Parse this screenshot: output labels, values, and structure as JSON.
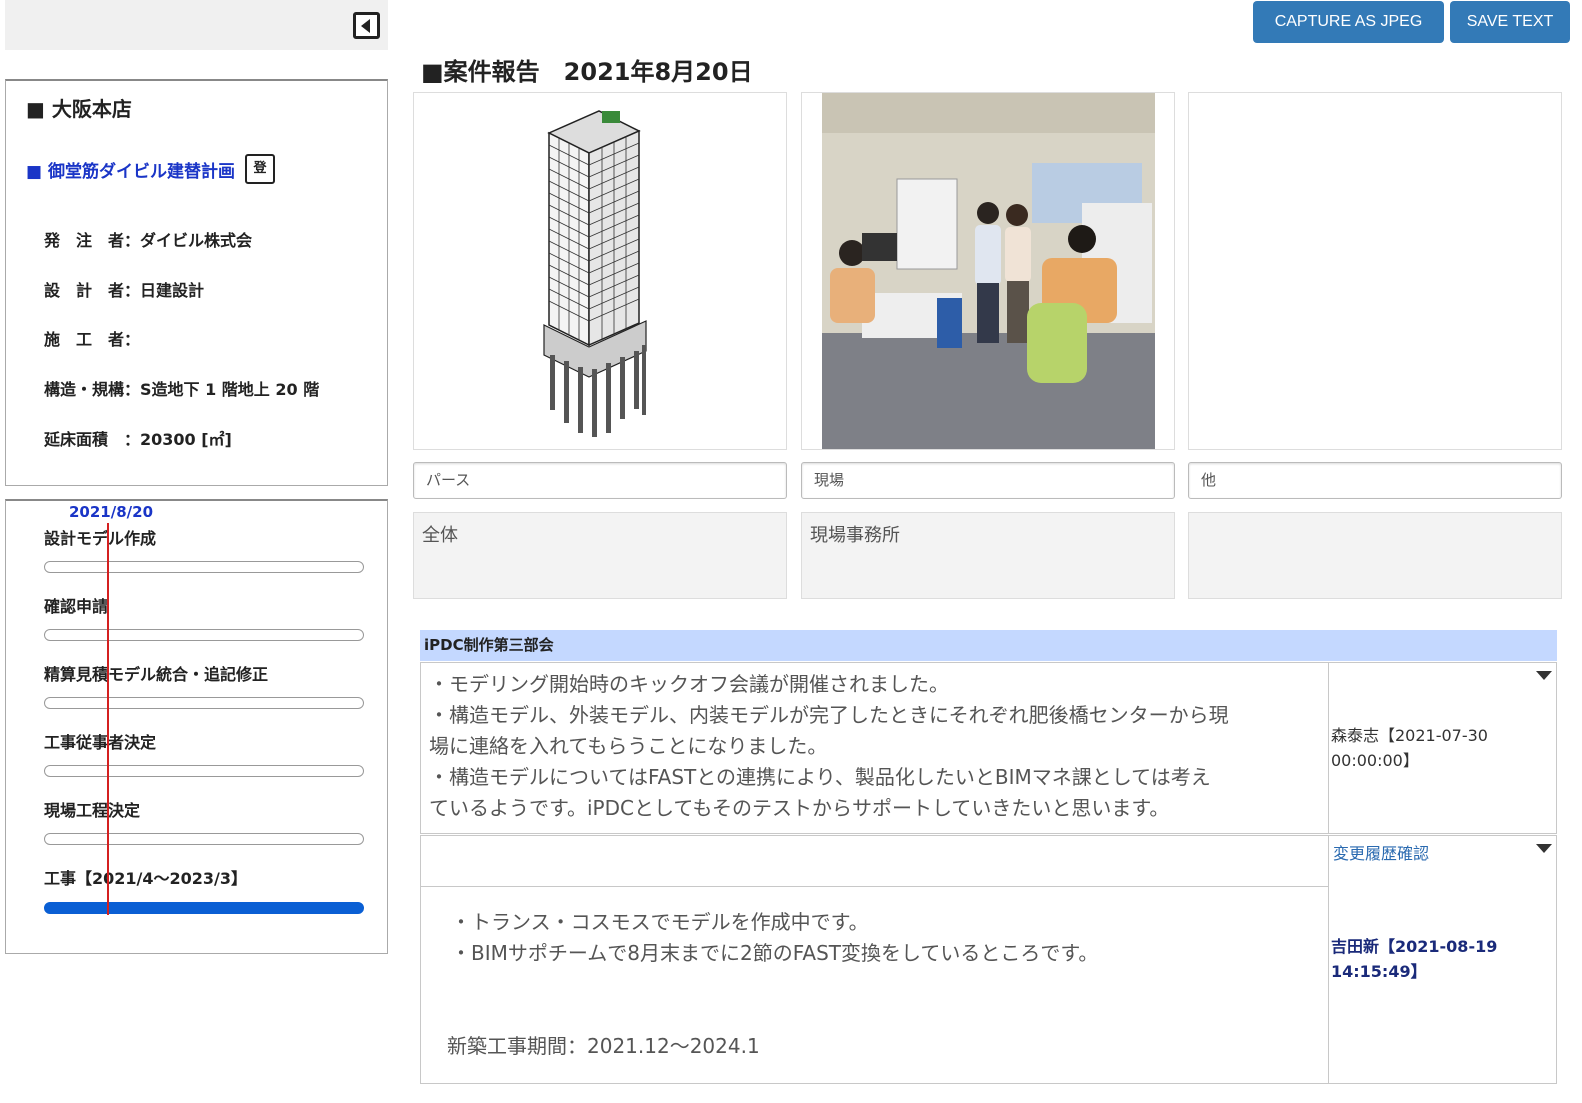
{
  "sidebar": {
    "branch": "■ 大阪本店",
    "project_name": "■ 御堂筋ダイビル建替計画",
    "register_label": "登",
    "info": [
      "発　注　者：ダイビル株式会",
      "設　計　者：日建設計",
      "施　工　者：",
      "構造・規構：S造地下 1 階地上 20 階",
      "延床面積　：20300 [㎡]"
    ],
    "schedule": {
      "today_label": "2021/8/20",
      "tasks": [
        {
          "label": "設計モデル作成",
          "progress": 0
        },
        {
          "label": "確認申請",
          "progress": 0
        },
        {
          "label": "精算見積モデル統合・追記修正",
          "progress": 0
        },
        {
          "label": "工事従事者決定",
          "progress": 0
        },
        {
          "label": "現場工程決定",
          "progress": 0
        },
        {
          "label": "工事【2021/4～2023/3】",
          "progress": 1
        }
      ]
    }
  },
  "toolbar": {
    "capture_label": "CAPTURE AS JPEG",
    "save_label": "SAVE TEXT"
  },
  "report": {
    "title": "■案件報告　2021年8月20日",
    "photos": [
      {
        "caption": "パース",
        "description": "全体",
        "kind": "building-model"
      },
      {
        "caption": "現場",
        "description": "現場事務所",
        "kind": "office-photo"
      },
      {
        "caption": "他",
        "description": "",
        "kind": "empty"
      }
    ]
  },
  "team": {
    "name": "iPDC制作第三部会",
    "entries": [
      {
        "lines": [
          "・モデリング開始時のキックオフ会議が開催されました。",
          "・構造モデル、外装モデル、内装モデルが完了したときにそれぞれ肥後橋センターから現",
          "場に連絡を入れてもらうことになりました。",
          "・構造モデルについてはFASTとの連携により、製品化したいとBIMマネ課としては考え",
          "ているようです。iPDCとしてもそのテストからサポートしていきたいと思います。"
        ],
        "author_line1": "森泰志【2021-07-30",
        "author_line2": "00:00:00】"
      },
      {
        "lines": [
          "・トランス・コスモスでモデルを作成中です。",
          "・BIMサポチームで8月末までに2節のFAST変換をしているところです。"
        ],
        "footer": "新築工事期間：2021.12～2024.1",
        "history_link": "変更履歴確認",
        "author_line1": "吉田新【2021-08-19",
        "author_line2": "14:15:49】"
      }
    ]
  },
  "colors": {
    "button": "#337ab7",
    "link_blue": "#1a35c7",
    "team_header": "#c4d8ff",
    "today_line": "#d42020",
    "progress_fill": "#0a5fd4"
  }
}
